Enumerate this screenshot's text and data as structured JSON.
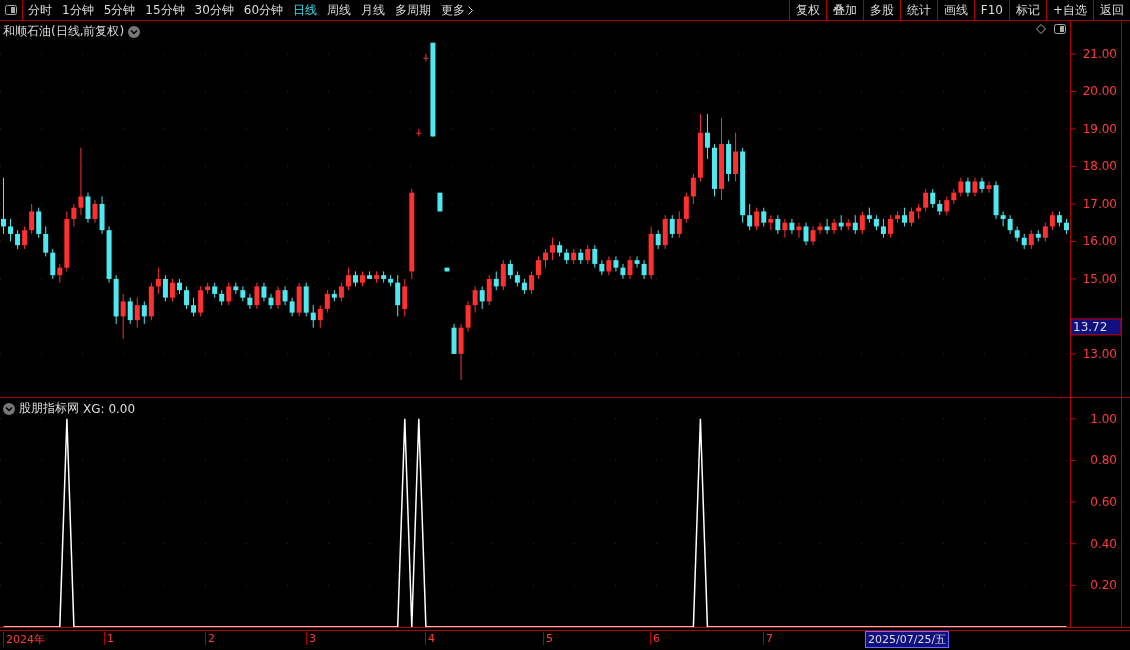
{
  "toolbar": {
    "periods": [
      {
        "label": "分时",
        "selected": false
      },
      {
        "label": "1分钟",
        "selected": false
      },
      {
        "label": "5分钟",
        "selected": false
      },
      {
        "label": "15分钟",
        "selected": false
      },
      {
        "label": "30分钟",
        "selected": false
      },
      {
        "label": "60分钟",
        "selected": false
      },
      {
        "label": "日线",
        "selected": true
      },
      {
        "label": "周线",
        "selected": false
      },
      {
        "label": "月线",
        "selected": false
      },
      {
        "label": "多周期",
        "selected": false
      },
      {
        "label": "更多",
        "selected": false
      }
    ],
    "actions": [
      "复权",
      "叠加",
      "多股",
      "统计",
      "画线",
      "F10",
      "标记",
      "+自选",
      "返回"
    ]
  },
  "price_chart": {
    "title": "和顺石油(日线,前复权)",
    "current_price": "13.72",
    "chart_data": {
      "type": "candlestick",
      "grid": true,
      "ylim": [
        11.85,
        21.88
      ],
      "yticks": [
        {
          "value": 21,
          "label": "21.00"
        },
        {
          "value": 20,
          "label": "20.00"
        },
        {
          "value": 19,
          "label": "19.00"
        },
        {
          "value": 18,
          "label": "18.00"
        },
        {
          "value": 17,
          "label": "17.00"
        },
        {
          "value": 16,
          "label": "16.00"
        },
        {
          "value": 15,
          "label": "15.00"
        },
        {
          "value": 13,
          "label": "13.00"
        }
      ],
      "categories": [
        null,
        null,
        null,
        null,
        null,
        null,
        null,
        null,
        null,
        null,
        null,
        null,
        null,
        null,
        null,
        null,
        null,
        null,
        null,
        null,
        null,
        null,
        null,
        null,
        null,
        null,
        null,
        null,
        null,
        null,
        null,
        null,
        null,
        null,
        null,
        null,
        null,
        null,
        null,
        null,
        null,
        null,
        null,
        null,
        null,
        null,
        null,
        null,
        null,
        null,
        null,
        null,
        null,
        null,
        null,
        null,
        null,
        null,
        null,
        null,
        null,
        null,
        null,
        null,
        null,
        null,
        null,
        null,
        null,
        null,
        null,
        null,
        null,
        null,
        null,
        null,
        null,
        null,
        null,
        null,
        null,
        null,
        null,
        null,
        null,
        null,
        null,
        null,
        null,
        null,
        null,
        null,
        null,
        null,
        null,
        null,
        null,
        null,
        null,
        null,
        null,
        null,
        null,
        null,
        null,
        null,
        null,
        null,
        null,
        null,
        null,
        null,
        null,
        null,
        null,
        null,
        null,
        null,
        null,
        null,
        null,
        null,
        null,
        null,
        null,
        null,
        null,
        null,
        null,
        null,
        null,
        null,
        null,
        null,
        null,
        null,
        null,
        null,
        null,
        null,
        null,
        null,
        null,
        null,
        null,
        null,
        null,
        null,
        null,
        null,
        null,
        null
      ],
      "ohlc": [
        [
          16.6,
          17.7,
          16.2,
          16.4
        ],
        [
          16.4,
          16.6,
          16.0,
          16.2
        ],
        [
          16.2,
          16.3,
          15.8,
          15.9
        ],
        [
          15.9,
          16.4,
          15.8,
          16.3
        ],
        [
          16.3,
          17.0,
          16.2,
          16.8
        ],
        [
          16.8,
          16.9,
          16.1,
          16.2
        ],
        [
          16.2,
          16.4,
          15.6,
          15.7
        ],
        [
          15.7,
          15.8,
          15.0,
          15.1
        ],
        [
          15.1,
          15.4,
          14.9,
          15.3
        ],
        [
          15.3,
          16.8,
          15.2,
          16.6
        ],
        [
          16.6,
          17.0,
          16.4,
          16.9
        ],
        [
          16.9,
          18.5,
          16.7,
          17.2
        ],
        [
          17.2,
          17.3,
          16.5,
          16.6
        ],
        [
          16.6,
          17.1,
          16.5,
          17.0
        ],
        [
          17.0,
          17.2,
          16.2,
          16.3
        ],
        [
          16.3,
          16.4,
          14.9,
          15.0
        ],
        [
          15.0,
          15.1,
          13.8,
          14.0
        ],
        [
          14.0,
          14.6,
          13.4,
          14.4
        ],
        [
          14.4,
          14.5,
          13.8,
          13.9
        ],
        [
          13.9,
          14.5,
          13.7,
          14.3
        ],
        [
          14.3,
          14.4,
          13.8,
          14.0
        ],
        [
          14.0,
          14.9,
          13.9,
          14.8
        ],
        [
          14.8,
          15.3,
          14.6,
          15.0
        ],
        [
          15.0,
          15.1,
          14.4,
          14.5
        ],
        [
          14.5,
          15.0,
          14.4,
          14.9
        ],
        [
          14.9,
          15.0,
          14.6,
          14.7
        ],
        [
          14.7,
          14.8,
          14.2,
          14.3
        ],
        [
          14.3,
          14.5,
          14.0,
          14.1
        ],
        [
          14.1,
          14.8,
          14.0,
          14.7
        ],
        [
          14.7,
          14.9,
          14.6,
          14.8
        ],
        [
          14.8,
          14.9,
          14.5,
          14.6
        ],
        [
          14.6,
          14.7,
          14.3,
          14.4
        ],
        [
          14.4,
          14.9,
          14.3,
          14.8
        ],
        [
          14.8,
          14.9,
          14.6,
          14.7
        ],
        [
          14.7,
          14.8,
          14.4,
          14.5
        ],
        [
          14.5,
          14.6,
          14.2,
          14.3
        ],
        [
          14.3,
          14.9,
          14.2,
          14.8
        ],
        [
          14.8,
          14.9,
          14.4,
          14.5
        ],
        [
          14.5,
          14.6,
          14.2,
          14.3
        ],
        [
          14.3,
          14.8,
          14.2,
          14.7
        ],
        [
          14.7,
          14.8,
          14.3,
          14.4
        ],
        [
          14.4,
          14.5,
          14.0,
          14.1
        ],
        [
          14.1,
          14.9,
          14.0,
          14.8
        ],
        [
          14.8,
          14.9,
          14.0,
          14.1
        ],
        [
          14.1,
          14.3,
          13.7,
          13.9
        ],
        [
          13.9,
          14.3,
          13.7,
          14.2
        ],
        [
          14.2,
          14.7,
          14.1,
          14.6
        ],
        [
          14.6,
          14.7,
          14.4,
          14.5
        ],
        [
          14.5,
          14.9,
          14.4,
          14.8
        ],
        [
          14.8,
          15.3,
          14.7,
          15.1
        ],
        [
          15.1,
          15.2,
          14.8,
          14.9
        ],
        [
          14.9,
          15.2,
          14.8,
          15.1
        ],
        [
          15.1,
          15.2,
          15.0,
          15.0
        ],
        [
          15.0,
          15.2,
          14.9,
          15.1
        ],
        [
          15.1,
          15.2,
          14.9,
          15.0
        ],
        [
          15.0,
          15.1,
          14.8,
          14.9
        ],
        [
          14.9,
          15.1,
          14.0,
          14.3
        ],
        [
          14.2,
          15.0,
          14.0,
          14.8
        ],
        [
          15.2,
          17.4,
          15.0,
          17.3
        ],
        [
          18.9,
          19.0,
          18.8,
          18.9
        ],
        [
          20.9,
          21.0,
          20.8,
          20.9
        ],
        [
          21.3,
          21.3,
          18.8,
          18.8
        ],
        [
          17.3,
          17.3,
          16.8,
          16.8
        ],
        [
          15.3,
          15.3,
          15.2,
          15.2
        ],
        [
          13.7,
          13.8,
          13.0,
          13.0
        ],
        [
          13.0,
          13.8,
          12.3,
          13.7
        ],
        [
          13.7,
          14.4,
          13.6,
          14.3
        ],
        [
          14.3,
          14.8,
          14.1,
          14.7
        ],
        [
          14.7,
          14.8,
          14.2,
          14.4
        ],
        [
          14.4,
          15.1,
          14.3,
          15.0
        ],
        [
          15.0,
          15.2,
          14.7,
          14.8
        ],
        [
          14.8,
          15.5,
          14.7,
          15.4
        ],
        [
          15.4,
          15.5,
          15.0,
          15.1
        ],
        [
          15.1,
          15.2,
          14.8,
          14.9
        ],
        [
          14.9,
          15.0,
          14.6,
          14.7
        ],
        [
          14.7,
          15.2,
          14.6,
          15.1
        ],
        [
          15.1,
          15.6,
          15.0,
          15.5
        ],
        [
          15.5,
          15.8,
          15.3,
          15.7
        ],
        [
          15.7,
          16.1,
          15.5,
          15.9
        ],
        [
          15.9,
          16.0,
          15.6,
          15.7
        ],
        [
          15.7,
          15.8,
          15.4,
          15.5
        ],
        [
          15.5,
          15.8,
          15.4,
          15.7
        ],
        [
          15.7,
          15.8,
          15.4,
          15.5
        ],
        [
          15.5,
          15.9,
          15.4,
          15.8
        ],
        [
          15.8,
          15.9,
          15.3,
          15.4
        ],
        [
          15.4,
          15.5,
          15.1,
          15.2
        ],
        [
          15.2,
          15.6,
          15.1,
          15.5
        ],
        [
          15.5,
          15.6,
          15.2,
          15.3
        ],
        [
          15.3,
          15.4,
          15.0,
          15.1
        ],
        [
          15.1,
          15.6,
          15.0,
          15.5
        ],
        [
          15.5,
          15.6,
          15.3,
          15.4
        ],
        [
          15.4,
          15.5,
          15.0,
          15.1
        ],
        [
          15.1,
          16.4,
          15.0,
          16.2
        ],
        [
          16.2,
          16.3,
          15.8,
          15.9
        ],
        [
          15.9,
          16.7,
          15.8,
          16.6
        ],
        [
          16.6,
          16.7,
          16.1,
          16.2
        ],
        [
          16.2,
          16.8,
          16.1,
          16.6
        ],
        [
          16.6,
          17.3,
          16.5,
          17.2
        ],
        [
          17.2,
          17.8,
          17.0,
          17.7
        ],
        [
          17.7,
          19.4,
          17.6,
          18.9
        ],
        [
          18.9,
          19.4,
          18.2,
          18.5
        ],
        [
          18.5,
          18.6,
          17.2,
          17.4
        ],
        [
          17.4,
          19.3,
          17.1,
          18.6
        ],
        [
          18.6,
          18.7,
          17.6,
          17.8
        ],
        [
          17.8,
          18.9,
          17.6,
          18.4
        ],
        [
          18.4,
          18.5,
          16.5,
          16.7
        ],
        [
          16.7,
          17.0,
          16.3,
          16.4
        ],
        [
          16.4,
          16.9,
          16.3,
          16.8
        ],
        [
          16.8,
          16.9,
          16.4,
          16.5
        ],
        [
          16.5,
          16.7,
          16.3,
          16.6
        ],
        [
          16.6,
          16.7,
          16.2,
          16.3
        ],
        [
          16.3,
          16.6,
          16.1,
          16.5
        ],
        [
          16.5,
          16.6,
          16.2,
          16.3
        ],
        [
          16.3,
          16.5,
          16.1,
          16.4
        ],
        [
          16.4,
          16.5,
          15.9,
          16.0
        ],
        [
          16.0,
          16.4,
          15.9,
          16.3
        ],
        [
          16.3,
          16.5,
          16.2,
          16.4
        ],
        [
          16.4,
          16.6,
          16.2,
          16.3
        ],
        [
          16.3,
          16.6,
          16.2,
          16.5
        ],
        [
          16.5,
          16.7,
          16.3,
          16.4
        ],
        [
          16.4,
          16.6,
          16.3,
          16.5
        ],
        [
          16.5,
          16.7,
          16.2,
          16.3
        ],
        [
          16.3,
          16.8,
          16.2,
          16.7
        ],
        [
          16.7,
          16.9,
          16.5,
          16.6
        ],
        [
          16.6,
          16.7,
          16.3,
          16.4
        ],
        [
          16.4,
          16.6,
          16.1,
          16.2
        ],
        [
          16.2,
          16.7,
          16.1,
          16.6
        ],
        [
          16.6,
          16.8,
          16.5,
          16.7
        ],
        [
          16.7,
          16.9,
          16.4,
          16.5
        ],
        [
          16.5,
          16.9,
          16.4,
          16.8
        ],
        [
          16.8,
          17.0,
          16.6,
          16.9
        ],
        [
          16.9,
          17.4,
          16.8,
          17.3
        ],
        [
          17.3,
          17.4,
          16.9,
          17.0
        ],
        [
          17.0,
          17.1,
          16.7,
          16.8
        ],
        [
          16.8,
          17.2,
          16.7,
          17.1
        ],
        [
          17.1,
          17.4,
          17.0,
          17.3
        ],
        [
          17.3,
          17.7,
          17.2,
          17.6
        ],
        [
          17.6,
          17.7,
          17.2,
          17.3
        ],
        [
          17.3,
          17.7,
          17.2,
          17.6
        ],
        [
          17.6,
          17.7,
          17.3,
          17.4
        ],
        [
          17.4,
          17.6,
          17.3,
          17.5
        ],
        [
          17.5,
          17.6,
          16.6,
          16.7
        ],
        [
          16.7,
          16.8,
          16.4,
          16.6
        ],
        [
          16.6,
          16.7,
          16.2,
          16.3
        ],
        [
          16.3,
          16.4,
          16.0,
          16.1
        ],
        [
          16.1,
          16.2,
          15.8,
          15.9
        ],
        [
          15.9,
          16.3,
          15.8,
          16.2
        ],
        [
          16.2,
          16.3,
          16.0,
          16.1
        ],
        [
          16.1,
          16.5,
          16.0,
          16.4
        ],
        [
          16.4,
          16.8,
          16.3,
          16.7
        ],
        [
          16.7,
          16.8,
          16.4,
          16.5
        ],
        [
          16.5,
          16.6,
          16.2,
          16.3
        ]
      ]
    }
  },
  "indicator": {
    "name": "股朋指标网",
    "reading": "XG: 0.00",
    "chart_data": {
      "type": "line",
      "grid": true,
      "ylim": [
        0,
        1.1
      ],
      "yticks": [
        {
          "value": 0.2,
          "label": "0.20"
        },
        {
          "value": 0.4,
          "label": "0.40"
        },
        {
          "value": 0.6,
          "label": "0.60"
        },
        {
          "value": 0.8,
          "label": "0.80"
        },
        {
          "value": 1.0,
          "label": "1.00"
        }
      ],
      "series": [
        {
          "color": "#ffffff",
          "values": [
            0,
            0,
            0,
            0,
            0,
            0,
            0,
            0,
            0,
            1,
            0,
            0,
            0,
            0,
            0,
            0,
            0,
            0,
            0,
            0,
            0,
            0,
            0,
            0,
            0,
            0,
            0,
            0,
            0,
            0,
            0,
            0,
            0,
            0,
            0,
            0,
            0,
            0,
            0,
            0,
            0,
            0,
            0,
            0,
            0,
            0,
            0,
            0,
            0,
            0,
            0,
            0,
            0,
            0,
            0,
            0,
            0,
            1,
            0,
            1,
            0,
            0,
            0,
            0,
            0,
            0,
            0,
            0,
            0,
            0,
            0,
            0,
            0,
            0,
            0,
            0,
            0,
            0,
            0,
            0,
            0,
            0,
            0,
            0,
            0,
            0,
            0,
            0,
            0,
            0,
            0,
            0,
            0,
            0,
            0,
            0,
            0,
            0,
            0,
            1,
            0,
            0,
            0,
            0,
            0,
            0,
            0,
            0,
            0,
            0,
            0,
            0,
            0,
            0,
            0,
            0,
            0,
            0,
            0,
            0,
            0,
            0,
            0,
            0,
            0,
            0,
            0,
            0,
            0,
            0,
            0,
            0,
            0,
            0,
            0,
            0,
            0,
            0,
            0,
            0,
            0,
            0,
            0,
            0,
            0,
            0,
            0,
            0,
            0,
            0,
            0,
            0
          ]
        }
      ],
      "categories": [
        null,
        null,
        null,
        null,
        null,
        null,
        null,
        null,
        null,
        null,
        null,
        null,
        null,
        null,
        null,
        null,
        null,
        null,
        null,
        null,
        null,
        null,
        null,
        null,
        null,
        null,
        null,
        null,
        null,
        null,
        null,
        null,
        null,
        null,
        null,
        null,
        null,
        null,
        null,
        null,
        null,
        null,
        null,
        null,
        null,
        null,
        null,
        null,
        null,
        null,
        null,
        null,
        null,
        null,
        null,
        null,
        null,
        null,
        null,
        null,
        null,
        null,
        null,
        null,
        null,
        null,
        null,
        null,
        null,
        null,
        null,
        null,
        null,
        null,
        null,
        null,
        null,
        null,
        null,
        null,
        null,
        null,
        null,
        null,
        null,
        null,
        null,
        null,
        null,
        null,
        null,
        null,
        null,
        null,
        null,
        null,
        null,
        null,
        null,
        null,
        null,
        null,
        null,
        null,
        null,
        null,
        null,
        null,
        null,
        null,
        null,
        null,
        null,
        null,
        null,
        null,
        null,
        null,
        null,
        null,
        null,
        null,
        null,
        null,
        null,
        null,
        null,
        null,
        null,
        null,
        null,
        null,
        null,
        null,
        null,
        null,
        null,
        null,
        null,
        null,
        null,
        null,
        null,
        null,
        null,
        null,
        null,
        null,
        null,
        null,
        null,
        null
      ]
    }
  },
  "time_axis": {
    "labels": [
      "2024年",
      "1",
      "2",
      "3",
      "4",
      "5",
      "6",
      "7"
    ],
    "cursor_date": "2025/07/25/五"
  }
}
